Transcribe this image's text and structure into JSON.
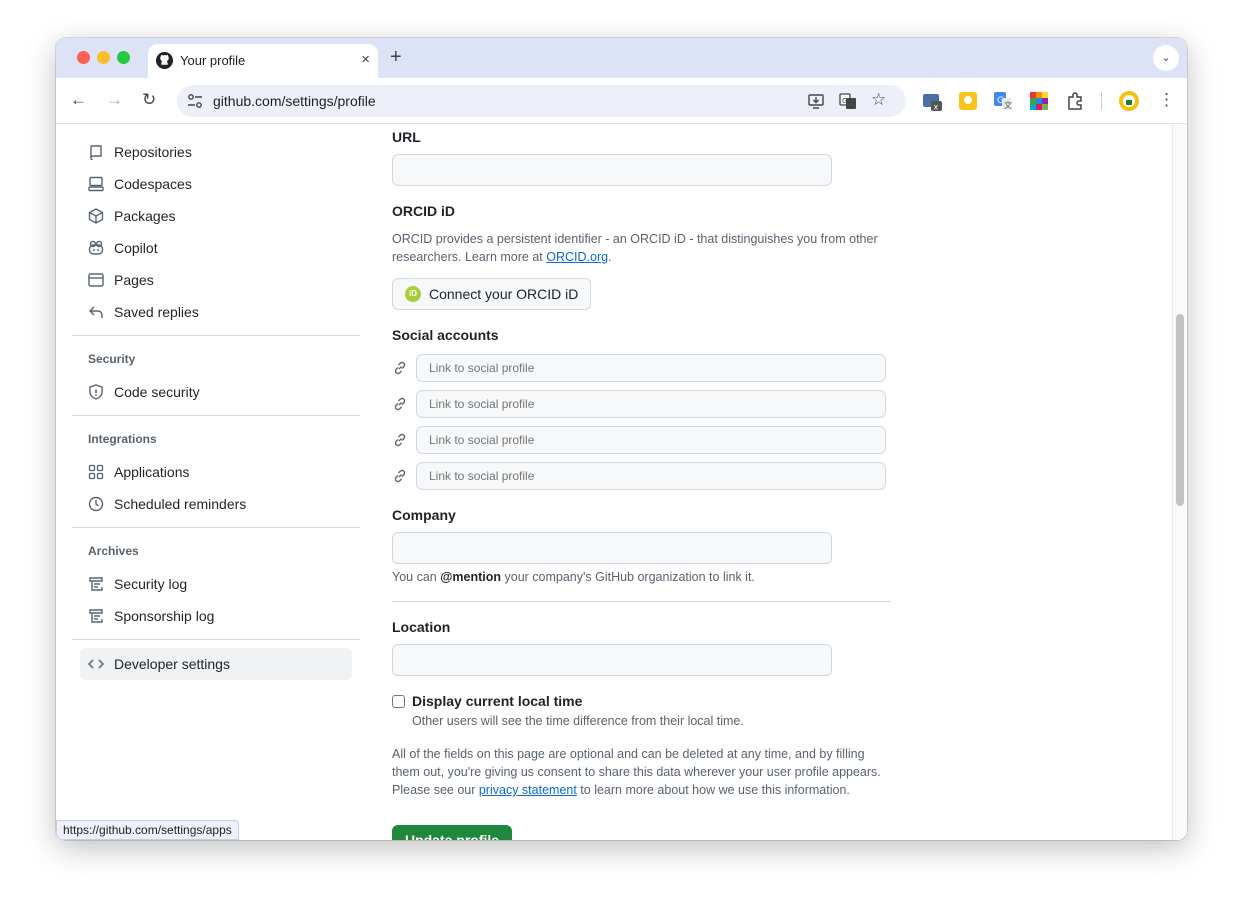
{
  "browser": {
    "tab_title": "Your profile",
    "tab_close": "×",
    "new_tab": "+",
    "tab_menu": "⌄",
    "url": "github.com/settings/profile",
    "status_url": "https://github.com/settings/apps"
  },
  "sidebar": {
    "items_top": [
      {
        "label": "Repositories",
        "icon": "repo-icon"
      },
      {
        "label": "Codespaces",
        "icon": "codespaces-icon"
      },
      {
        "label": "Packages",
        "icon": "package-icon"
      },
      {
        "label": "Copilot",
        "icon": "copilot-icon"
      },
      {
        "label": "Pages",
        "icon": "browser-icon"
      },
      {
        "label": "Saved replies",
        "icon": "reply-icon"
      }
    ],
    "security_head": "Security",
    "code_security": "Code security",
    "integrations_head": "Integrations",
    "applications": "Applications",
    "scheduled_reminders": "Scheduled reminders",
    "archives_head": "Archives",
    "security_log": "Security log",
    "sponsorship_log": "Sponsorship log",
    "developer_settings": "Developer settings"
  },
  "form": {
    "url_label": "URL",
    "url_value": "",
    "orcid_label": "ORCID iD",
    "orcid_note_prefix": "ORCID provides a persistent identifier - an ORCID iD - that distinguishes you from other researchers. Learn more at ",
    "orcid_link": "ORCID.org",
    "orcid_note_suffix": ".",
    "orcid_button": "Connect your ORCID iD",
    "orcid_icon_text": "iD",
    "social_label": "Social accounts",
    "social_placeholder": "Link to social profile",
    "company_label": "Company",
    "company_value": "",
    "company_note_prefix": "You can ",
    "company_note_mention": "@mention",
    "company_note_suffix": " your company's GitHub organization to link it.",
    "location_label": "Location",
    "location_value": "",
    "local_time_label": "Display current local time",
    "local_time_note": "Other users will see the time difference from their local time.",
    "local_time_checked": false,
    "consent_prefix": "All of the fields on this page are optional and can be deleted at any time, and by filling them out, you're giving us consent to share this data wherever your user profile appears. Please see our ",
    "consent_link": "privacy statement",
    "consent_suffix": " to learn more about how we use this information.",
    "update_button": "Update profile"
  },
  "colors": {
    "primary_button": "#1f883d",
    "link": "#0969da",
    "tab_strip": "#dde3f7"
  }
}
